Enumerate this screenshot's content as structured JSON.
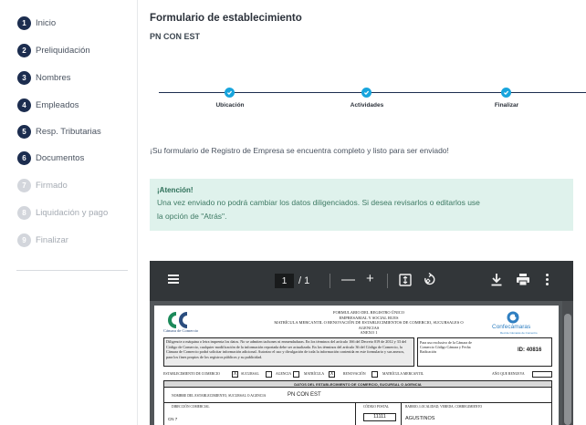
{
  "sidebar": {
    "steps": [
      {
        "num": "1",
        "label": "Inicio",
        "state": "done"
      },
      {
        "num": "2",
        "label": "Preliquidación",
        "state": "done"
      },
      {
        "num": "3",
        "label": "Nombres",
        "state": "done"
      },
      {
        "num": "4",
        "label": "Empleados",
        "state": "done"
      },
      {
        "num": "5",
        "label": "Resp. Tributarias",
        "state": "done"
      },
      {
        "num": "6",
        "label": "Documentos",
        "state": "done"
      },
      {
        "num": "7",
        "label": "Firmado",
        "state": "pending"
      },
      {
        "num": "8",
        "label": "Liquidación y pago",
        "state": "pending"
      },
      {
        "num": "9",
        "label": "Finalizar",
        "state": "pending"
      }
    ]
  },
  "header": {
    "title": "Formulario de establecimiento",
    "subtitle": "PN CON EST"
  },
  "progress": {
    "steps": [
      "Ubicación",
      "Actividades",
      "Finalizar"
    ],
    "node_color": "#18a5dd"
  },
  "message": "¡Su formulario de Registro de Empresa se encuentra completo y listo para ser enviado!",
  "alert": {
    "title": "¡Atención!",
    "body": "Una vez enviado no podrá cambiar los datos diligenciados. Si desea revisarlos o editarlos use la opción de \"Atrás\".",
    "bg_color": "#dff2ec"
  },
  "pdf_viewer": {
    "current_page": "1",
    "total": "/ 1",
    "minus": "—",
    "plus": "+",
    "icons": [
      "menu-icon",
      "fit-page-icon",
      "rotate-icon",
      "download-icon",
      "print-icon",
      "more-icon"
    ],
    "document": {
      "logo_text": "Cámara de Comercio",
      "header_lines": [
        "FORMULARIO DEL REGISTRO ÚNICO",
        "EMPRESARIAL Y SOCIAL RUES",
        "MATRÍCULA MERCANTIL O RENOVACIÓN DE ESTABLECIMIENTOS DE COMERCIO, SUCURSALES O AGENCIAS",
        "ANEXO 1"
      ],
      "brand": "Confecámaras",
      "brand_sub": "Red de Cámaras de Comercio",
      "instructions": "Diligencie a máquina o letra imprenta los datos. No se admiten tachones ni enmendaduras. En los términos del artículo 166 del Decreto 019 de 2012 y 33 del Código de Comercio, cualquier modificación de la información reportada debe ser actualizada. En los términos del artículo 36 del Código de Comercio, la Cámara de Comercio podrá solicitar información adicional. Autorizo el uso y divulgación de toda la información contenida en este formulario y sus anexos, para los fines propios de los registros públicos y su publicidad.",
      "exclusive_use": "Para uso exclusivo de la Cámara de Comercio Código Cámara y Fecha Radicación",
      "id": "ID: 40816",
      "row_labels": [
        "ESTABLECIMIENTO DE COMERCIO",
        "SUCURSAL",
        "AGENCIA",
        "MATRÍCULA",
        "RENOVACIÓN",
        "MATRÍCULA MERCANTIL",
        "AÑO QUE RENUEVA"
      ],
      "establecimiento_mark": "X",
      "matricula_mark": "X",
      "section_title": "DATOS DEL ESTABLECIMIENTO DE COMERCIO, SUCURSAL O AGENCIA",
      "name_label": "NOMBRE DEL ESTABLECIMIENTO, SUCURSAL O AGENCIA",
      "name_value": "PN CON EST",
      "address_label": "DIRECCIÓN COMERCIAL",
      "address_value": "CN 7",
      "postal_label": "CÓDIGO POSTAL",
      "postal_value": "11111",
      "barrio_label": "BARRIO, LOCALIDAD, VEREDA, CORREGIMIENTO",
      "barrio_value": "AGUSTINOS"
    }
  }
}
